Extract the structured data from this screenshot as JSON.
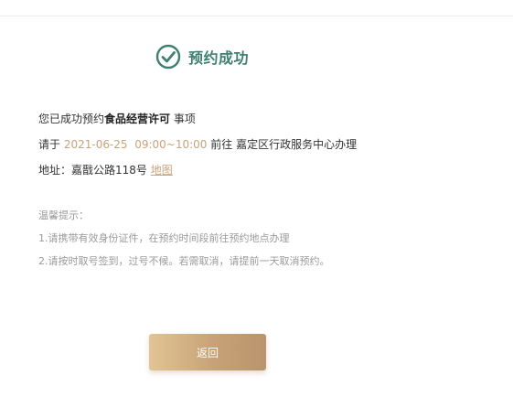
{
  "header": {
    "title": "预约成功"
  },
  "confirmation": {
    "line1_prefix": "您已成功预约",
    "item_name": "食品经营许可",
    "line1_suffix": " 事项",
    "line2_prefix": "请于 ",
    "appointment_date": "2021-06-25",
    "appointment_time": "09:00~10:00",
    "line2_mid": " 前往 ",
    "location_name": "嘉定区行政服务中心办理",
    "address_label": "地址：",
    "address": "嘉戬公路118号",
    "map_link": "地图"
  },
  "tips": {
    "title": "温馨提示：",
    "items": [
      "1.请携带有效身份证件，在预约时间段前往预约地点办理",
      "2.请按时取号签到，过号不候。若需取消，请提前一天取消预约。"
    ]
  },
  "actions": {
    "back_label": "返回"
  },
  "colors": {
    "success": "#3f7f6f",
    "accent_gold": "#c8a37a",
    "button_gradient_start": "#e2c594",
    "button_gradient_end": "#b9946c"
  },
  "icons": {
    "success": "check-circle-icon"
  }
}
